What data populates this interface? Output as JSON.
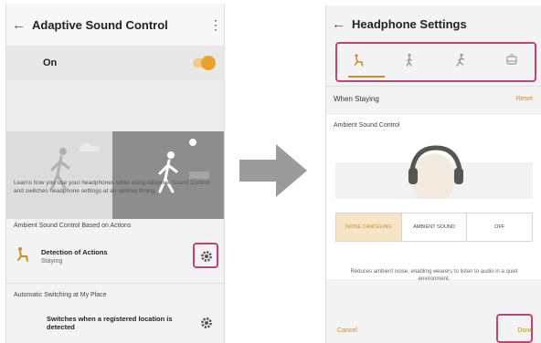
{
  "left_screen": {
    "title": "Adaptive Sound Control",
    "toggle_label": "On",
    "toggle_state": "on",
    "description": "Learns how you use your headphones while using Adaptive Sound Control and switches headphone settings at an optimal timing.",
    "section_actions": "Ambient Sound Control Based on Actions",
    "detection_title": "Detection of Actions",
    "detection_value": "Staying",
    "section_place": "Automatic Switching at My Place",
    "place_text": "Switches when a registered location is detected"
  },
  "right_screen": {
    "title": "Headphone Settings",
    "tabs": [
      "staying",
      "walking",
      "running",
      "transport"
    ],
    "mode_label": "When Staying",
    "reset_label": "Reset",
    "ambient_title": "Ambient Sound Control",
    "options": [
      "NOISE CANCELING",
      "AMBIENT SOUND",
      "OFF"
    ],
    "selected_option": "NOISE CANCELING",
    "description": "Reduces ambient noise, enabling wearers to listen to audio in a quiet environment.",
    "cancel_label": "Cancel",
    "done_label": "Done"
  },
  "colors": {
    "accent": "#c98b2c",
    "callout": "#b5477a",
    "arrow": "#9b9b9b"
  }
}
